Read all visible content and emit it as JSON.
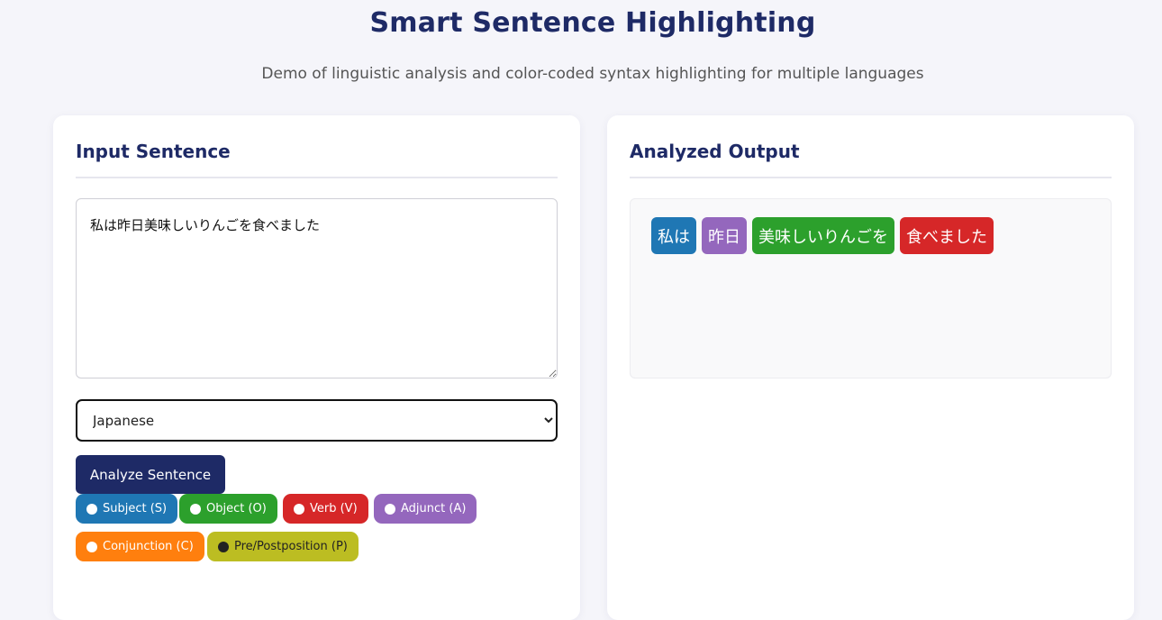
{
  "header": {
    "title": "Smart Sentence Highlighting",
    "subtitle": "Demo of linguistic analysis and color-coded syntax highlighting for multiple languages"
  },
  "input_panel": {
    "heading": "Input Sentence",
    "sentence_value": "私は昨日美味しいりんごを食べました",
    "language_selected": "Japanese",
    "analyze_label": "Analyze Sentence"
  },
  "legend": [
    {
      "label": "Subject (S)",
      "color": "#1f77b4",
      "dot": "#ffffff"
    },
    {
      "label": "Object (O)",
      "color": "#2ca02c",
      "dot": "#ffffff"
    },
    {
      "label": "Verb (V)",
      "color": "#d62728",
      "dot": "#ffffff"
    },
    {
      "label": "Adjunct (A)",
      "color": "#9467bd",
      "dot": "#ffffff"
    },
    {
      "label": "Conjunction (C)",
      "color": "#ff7f0e",
      "dot": "#ffffff"
    },
    {
      "label": "Pre/Postposition (P)",
      "color": "#bcbd22",
      "dot": "#222222",
      "text_color": "#222222"
    }
  ],
  "output_panel": {
    "heading": "Analyzed Output",
    "tokens": [
      {
        "text": "私は",
        "role": "subject",
        "color": "#1f77b4"
      },
      {
        "text": "昨日",
        "role": "adjunct",
        "color": "#9467bd"
      },
      {
        "text": "美味しいりんごを",
        "role": "object",
        "color": "#2ca02c"
      },
      {
        "text": "食べました",
        "role": "verb",
        "color": "#d62728"
      }
    ]
  }
}
